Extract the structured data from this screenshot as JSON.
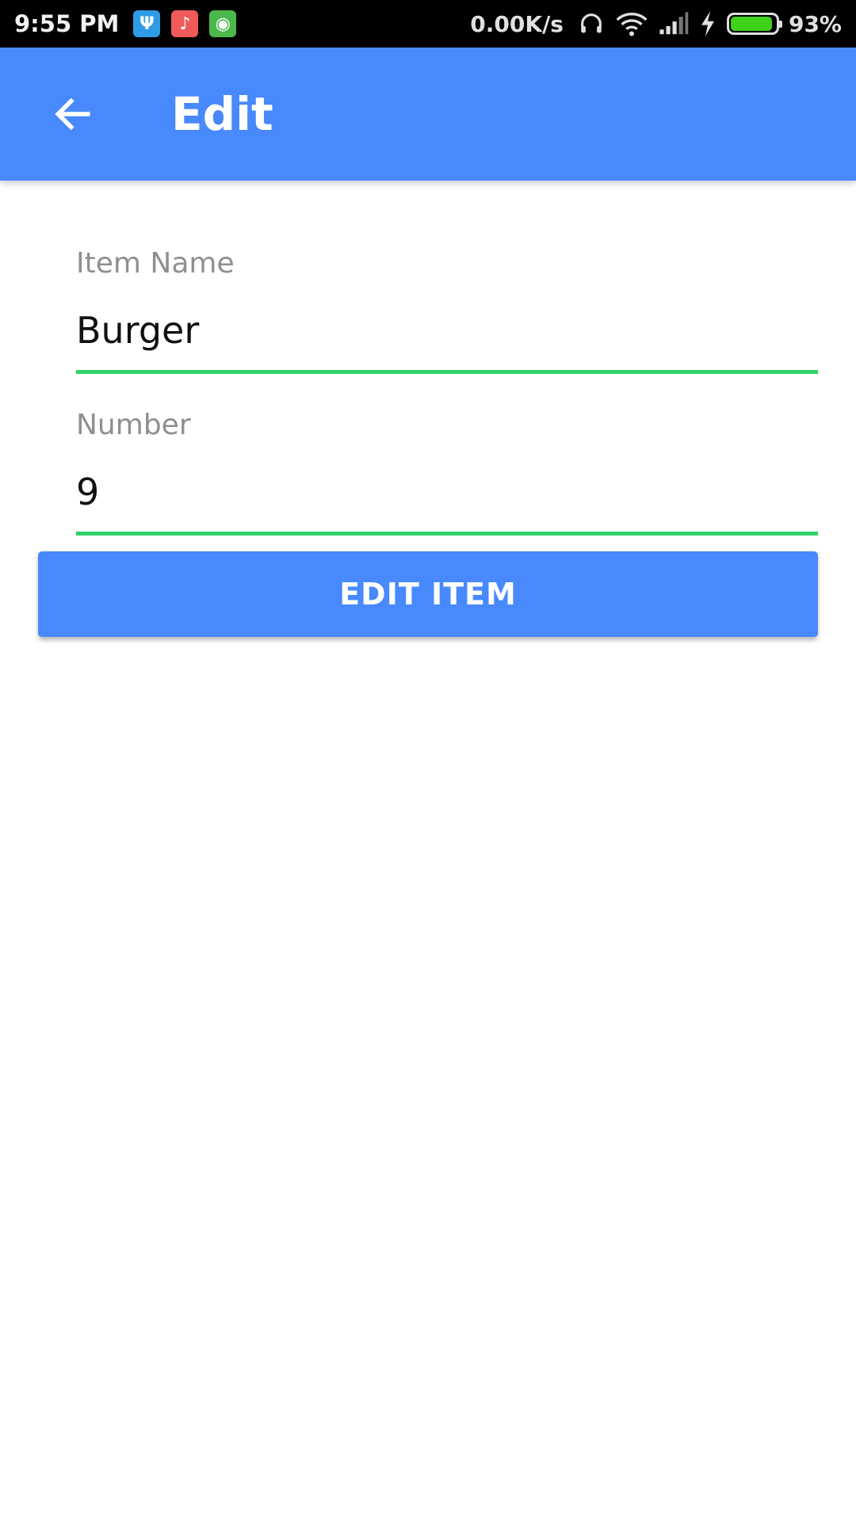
{
  "status_bar": {
    "time": "9:55 PM",
    "network_speed": "0.00K/s",
    "battery_percent": "93%",
    "battery_level": 0.93,
    "notification_icons": [
      {
        "name": "usb-icon",
        "glyph": "Ψ",
        "color": "#2e9be6"
      },
      {
        "name": "music-icon",
        "glyph": "♪",
        "color": "#f05a5a"
      },
      {
        "name": "android-icon",
        "glyph": "◉",
        "color": "#4cb84c"
      }
    ],
    "system_icons": [
      "headset-icon",
      "wifi-icon",
      "signal-icon",
      "charging-icon",
      "battery-icon"
    ]
  },
  "app_bar": {
    "title": "Edit",
    "back_icon": "arrow-left-icon",
    "background_color": "#4889fd"
  },
  "form": {
    "item_name": {
      "label": "Item Name",
      "value": "Burger"
    },
    "number": {
      "label": "Number",
      "value": "9"
    },
    "underline_color": "#31d266"
  },
  "actions": {
    "edit_item_label": "EDIT ITEM",
    "button_color": "#4889fd"
  }
}
